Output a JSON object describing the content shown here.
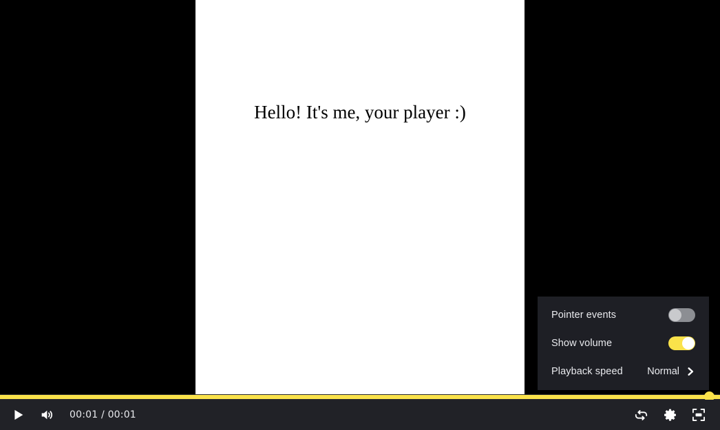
{
  "player": {
    "video": {
      "caption": "Hello! It's me, your player :)",
      "background_color": "#ffffff",
      "letterbox_color": "#000000"
    },
    "accent_color": "#fae24a",
    "controls_background": "#212227",
    "progress": {
      "percent": 100,
      "knob_position_percent": 98.6
    },
    "controls": {
      "play_label": "play-icon",
      "volume_label": "volume-high-icon",
      "time_current": "00:01",
      "time_separator": "/",
      "time_total": "00:01",
      "time_display": "00:01 / 00:01",
      "loop_label": "loop-icon",
      "settings_label": "gear-icon",
      "pip_label": "picture-in-picture-icon"
    },
    "settings_panel": {
      "background_color": "#1e1f25",
      "rows": [
        {
          "label": "Pointer events",
          "type": "toggle",
          "state": "off"
        },
        {
          "label": "Show volume",
          "type": "toggle",
          "state": "on"
        },
        {
          "label": "Playback speed",
          "type": "submenu",
          "value": "Normal"
        }
      ]
    }
  }
}
